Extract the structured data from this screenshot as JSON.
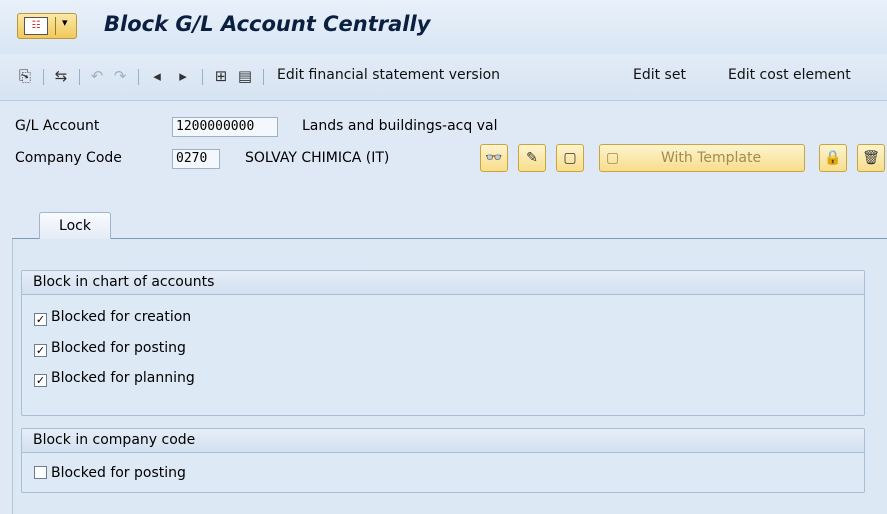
{
  "window": {
    "title": "Block G/L Account Centrally",
    "menu_icon": "sap-menu-icon"
  },
  "toolbar": {
    "icons": [
      "display-change-icon",
      "other-object-icon",
      "undo-icon",
      "redo-icon",
      "prev-icon",
      "next-icon",
      "layout-icon",
      "doc-icon"
    ],
    "links": [
      "Edit financial statement version",
      "Edit set",
      "Edit cost element"
    ]
  },
  "header": {
    "gl_account_label": "G/L Account",
    "gl_account_value": "1200000000",
    "gl_account_desc": "Lands and buildings-acq val",
    "company_code_label": "Company Code",
    "company_code_value": "0270",
    "company_code_desc": "SOLVAY CHIMICA (IT)",
    "with_template_label": "With Template"
  },
  "tabs": [
    {
      "label": "Lock"
    }
  ],
  "groups": [
    {
      "title": "Block in chart of accounts",
      "items": [
        {
          "label": "Blocked for creation",
          "checked": true
        },
        {
          "label": "Blocked for posting",
          "checked": true
        },
        {
          "label": "Blocked for planning",
          "checked": true
        }
      ]
    },
    {
      "title": "Block in company code",
      "items": [
        {
          "label": "Blocked for posting",
          "checked": false
        }
      ]
    }
  ]
}
